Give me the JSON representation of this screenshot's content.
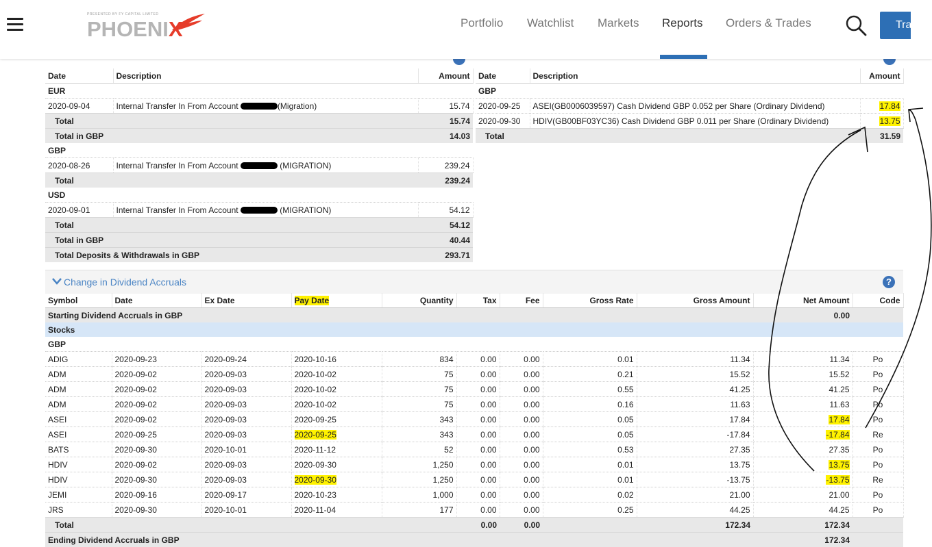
{
  "header": {
    "logo_small": "PRESENTED BY FY CAPITAL LIMITED",
    "logo_main": "PHOENI",
    "logo_x": "X",
    "nav": [
      "Portfolio",
      "Watchlist",
      "Markets",
      "Reports",
      "Orders & Trades"
    ],
    "active_nav": "Reports",
    "trade_label": "Trade",
    "brand_color": "#2d6fb5"
  },
  "deposits": {
    "headers": [
      "Date",
      "Description",
      "Amount"
    ],
    "eur_label": "EUR",
    "eur_row": [
      "2020-09-04",
      "Internal Transfer In From Account ",
      "(Migration)",
      "15.74"
    ],
    "eur_total": [
      "Total",
      "15.74"
    ],
    "eur_total_gbp": [
      "Total in GBP",
      "14.03"
    ],
    "gbp_label": "GBP",
    "gbp_row": [
      "2020-08-26",
      "Internal Transfer In From Account ",
      "(MIGRATION)",
      "239.24"
    ],
    "gbp_total": [
      "Total",
      "239.24"
    ],
    "usd_label": "USD",
    "usd_row": [
      "2020-09-01",
      "Internal Transfer In From Account ",
      "(MIGRATION)",
      "54.12"
    ],
    "usd_total": [
      "Total",
      "54.12"
    ],
    "usd_total_gbp": [
      "Total in GBP",
      "40.44"
    ],
    "grand_total": [
      "Total Deposits & Withdrawals in GBP",
      "293.71"
    ]
  },
  "dividends": {
    "headers": [
      "Date",
      "Description",
      "Amount"
    ],
    "gbp_label": "GBP",
    "rows": [
      [
        "2020-09-25",
        "ASEI(GB0006039597) Cash Dividend GBP 0.052 per Share (Ordinary Dividend)",
        "17.84"
      ],
      [
        "2020-09-30",
        "HDIV(GB00BF03YC36) Cash Dividend GBP 0.011 per Share (Ordinary Dividend)",
        "13.75"
      ]
    ],
    "total": [
      "Total",
      "31.59"
    ]
  },
  "accruals": {
    "title": "Change in Dividend Accruals",
    "headers": [
      "Symbol",
      "Date",
      "Ex Date",
      "Pay Date",
      "Quantity",
      "Tax",
      "Fee",
      "Gross Rate",
      "Gross Amount",
      "Net Amount",
      "Code"
    ],
    "starting": [
      "Starting Dividend Accruals in GBP",
      "0.00"
    ],
    "stocks_label": "Stocks",
    "gbp_label": "GBP",
    "rows": [
      [
        "ADIG",
        "2020-09-23",
        "2020-09-24",
        "2020-10-16",
        "834",
        "0.00",
        "0.00",
        "0.01",
        "11.34",
        "11.34",
        "Po"
      ],
      [
        "ADM",
        "2020-09-02",
        "2020-09-03",
        "2020-10-02",
        "75",
        "0.00",
        "0.00",
        "0.21",
        "15.52",
        "15.52",
        "Po"
      ],
      [
        "ADM",
        "2020-09-02",
        "2020-09-03",
        "2020-10-02",
        "75",
        "0.00",
        "0.00",
        "0.55",
        "41.25",
        "41.25",
        "Po"
      ],
      [
        "ADM",
        "2020-09-02",
        "2020-09-03",
        "2020-10-02",
        "75",
        "0.00",
        "0.00",
        "0.16",
        "11.63",
        "11.63",
        "Po"
      ],
      [
        "ASEI",
        "2020-09-02",
        "2020-09-03",
        "2020-09-25",
        "343",
        "0.00",
        "0.00",
        "0.05",
        "17.84",
        "17.84",
        "Po"
      ],
      [
        "ASEI",
        "2020-09-25",
        "2020-09-03",
        "2020-09-25",
        "343",
        "0.00",
        "0.00",
        "0.05",
        "-17.84",
        "-17.84",
        "Re"
      ],
      [
        "BATS",
        "2020-09-30",
        "2020-10-01",
        "2020-11-12",
        "52",
        "0.00",
        "0.00",
        "0.53",
        "27.35",
        "27.35",
        "Po"
      ],
      [
        "HDIV",
        "2020-09-02",
        "2020-09-03",
        "2020-09-30",
        "1,250",
        "0.00",
        "0.00",
        "0.01",
        "13.75",
        "13.75",
        "Po"
      ],
      [
        "HDIV",
        "2020-09-30",
        "2020-09-03",
        "2020-09-30",
        "1,250",
        "0.00",
        "0.00",
        "0.01",
        "-13.75",
        "-13.75",
        "Re"
      ],
      [
        "JEMI",
        "2020-09-16",
        "2020-09-17",
        "2020-10-23",
        "1,000",
        "0.00",
        "0.00",
        "0.02",
        "21.00",
        "21.00",
        "Po"
      ],
      [
        "JRS",
        "2020-09-30",
        "2020-10-01",
        "2020-11-04",
        "177",
        "0.00",
        "0.00",
        "0.25",
        "44.25",
        "44.25",
        "Po"
      ]
    ],
    "total": [
      "Total",
      "0.00",
      "0.00",
      "172.34",
      "172.34"
    ],
    "ending": [
      "Ending Dividend Accruals in GBP",
      "172.34"
    ]
  },
  "colors": {
    "highlight": "#fff200",
    "link_blue": "#4a84c4",
    "subtotal_gray": "#e8e8e8",
    "stocks_blue": "#d6e6f7"
  }
}
